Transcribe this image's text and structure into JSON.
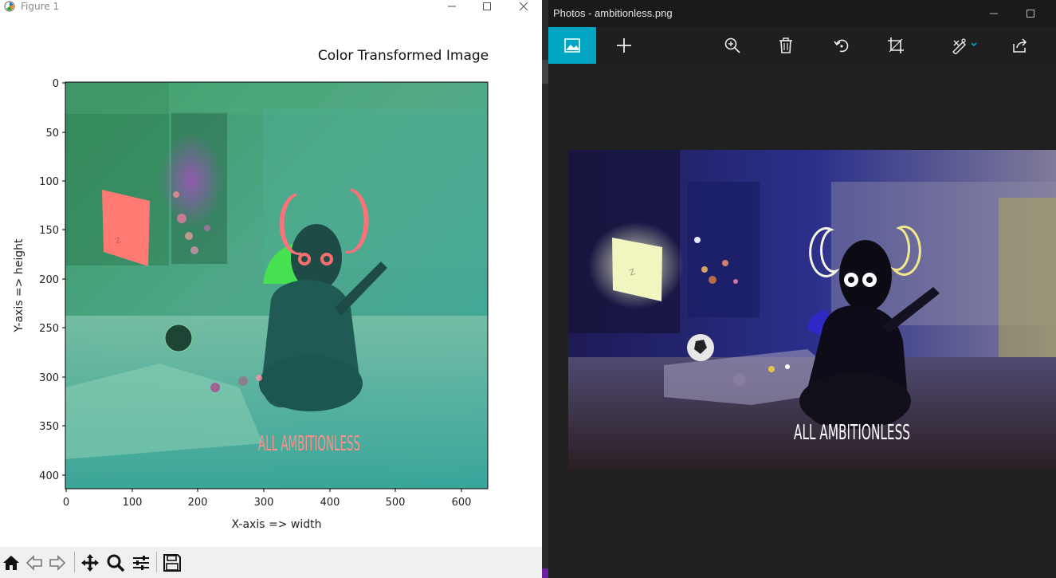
{
  "figure_window": {
    "title": "Figure 1",
    "plot_title": "Color Transformed Image",
    "xlabel": "X-axis => width",
    "ylabel": "Y-axis => height",
    "x_ticks": [
      "0",
      "100",
      "200",
      "300",
      "400",
      "500",
      "600"
    ],
    "y_ticks": [
      "0",
      "50",
      "100",
      "150",
      "200",
      "250",
      "300",
      "350",
      "400"
    ],
    "image_text": "ALL AMBITIONLESS"
  },
  "figure_toolbar": {
    "buttons": [
      "home-icon",
      "back-icon",
      "forward-icon",
      "pan-icon",
      "zoom-icon",
      "configure-subplots-icon",
      "save-icon"
    ]
  },
  "photos_window": {
    "title": "Photos - ambitionless.png",
    "toolbar_icons": [
      "view-image-icon",
      "add-icon",
      "zoom-in-icon",
      "delete-icon",
      "rotate-icon",
      "crop-icon",
      "edit-create-icon",
      "share-icon"
    ],
    "image_text": "ALL AMBITIONLESS"
  },
  "colors": {
    "photos_accent": "#00a6c1",
    "photos_bg": "#202020",
    "mpl_toolbar_bg": "#f0f0f0"
  }
}
